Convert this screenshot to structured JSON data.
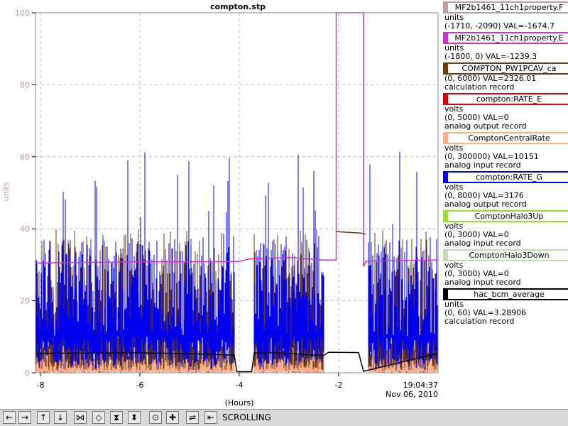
{
  "chart_data": {
    "type": "line",
    "title": "compton.stp",
    "xlabel": "(Hours)",
    "ylabel": "units",
    "xlim": [
      -8.1,
      0
    ],
    "ylim": [
      0,
      100
    ],
    "x_ticks": [
      -8,
      -6,
      -4,
      -2
    ],
    "y_ticks": [
      0,
      20,
      40,
      60,
      80,
      100
    ],
    "grid": true,
    "timestamp": [
      "19:04:37",
      "Nov 06, 2010"
    ],
    "series": [
      {
        "name": "MF2b1461_11ch1property.E",
        "color": "#cc33cc",
        "x": [
          -8.1,
          -6,
          -4,
          -3.8,
          -3,
          -2.3,
          -2.05,
          -2.05,
          -1.5,
          -1.5,
          -1.45,
          0
        ],
        "y": [
          30.5,
          30.8,
          30.9,
          31.6,
          32,
          31.3,
          31.3,
          100,
          100,
          29.5,
          31,
          31.3
        ]
      },
      {
        "name": "COMPTON_PW1PCAV_ca",
        "color": "#6b3a10",
        "x": [
          -2.05,
          -1.55,
          -1.45
        ],
        "y": [
          39.2,
          38.8,
          38.5
        ]
      },
      {
        "name": "hac_bcm_average",
        "color": "#000000",
        "x": [
          -8.1,
          -6,
          -5,
          -4.1,
          -4.05,
          -3.75,
          -3.7,
          -3.2,
          -2.3,
          -2.2,
          -1.6,
          -1.5,
          0
        ],
        "y": [
          5.4,
          5.5,
          5.3,
          4.9,
          0.3,
          0.3,
          5.5,
          5.5,
          4.8,
          5.7,
          5.6,
          0.4,
          5.4
        ]
      }
    ],
    "legend": [
      {
        "name": "MF2b1461_11ch1property.F",
        "color": "#c49c9c",
        "lines": [
          "units",
          "(-1710, -2090) VAL=-1674.7"
        ]
      },
      {
        "name": "MF2b1461_11ch1property.E",
        "color": "#cc33cc",
        "lines": [
          "units",
          "(-1800, 0) VAL=-1239.3"
        ]
      },
      {
        "name": "COMPTON_PW1PCAV_ca",
        "color": "#6b3a10",
        "lines": [
          "(0, 6000) VAL=2326.01",
          "calculation record"
        ]
      },
      {
        "name": "compton:RATE_E",
        "color": "#dd0000",
        "lines": [
          "volts",
          "(0, 5000) VAL=0",
          "analog output record"
        ]
      },
      {
        "name": "ComptonCentralRate",
        "color": "#ffb08a",
        "lines": [
          "volts",
          "(0, 300000) VAL=10151",
          "analog input record"
        ]
      },
      {
        "name": "compton:RATE_G",
        "color": "#0000ee",
        "lines": [
          "volts",
          "(0, 8000) VAL=3176",
          "analog output record"
        ]
      },
      {
        "name": "ComptonHalo3Up",
        "color": "#99dd33",
        "lines": [
          "volts",
          "(0, 3000) VAL=0",
          "analog input record"
        ]
      },
      {
        "name": "ComptonHalo3Down",
        "color": "#c4dcb4",
        "lines": [
          "volts",
          "(0, 3000) VAL=0",
          "analog input record"
        ]
      },
      {
        "name": "hac_bcm_average",
        "color": "#000000",
        "lines": [
          "units",
          "(0, 60) VAL=3.28906",
          "calculation record"
        ]
      }
    ]
  },
  "toolbar": {
    "buttons": [
      {
        "name": "scroll-left-button",
        "glyph": "←"
      },
      {
        "name": "scroll-right-button",
        "glyph": "→"
      },
      {
        "name": "scroll-up-button",
        "glyph": "↑"
      },
      {
        "name": "scroll-down-button",
        "glyph": "↓"
      },
      {
        "name": "zoom-in-x-button",
        "glyph": "⋈"
      },
      {
        "name": "zoom-out-x-button",
        "glyph": "◇"
      },
      {
        "name": "zoom-in-y-button",
        "glyph": "⧗"
      },
      {
        "name": "zoom-out-y-button",
        "glyph": "⬍"
      },
      {
        "name": "auto-scale-button",
        "glyph": "⊙"
      },
      {
        "name": "reset-button",
        "glyph": "✚"
      },
      {
        "name": "mode-button",
        "glyph": "⇌"
      },
      {
        "name": "end-button",
        "glyph": "⇤"
      }
    ],
    "status": "SCROLLING"
  }
}
